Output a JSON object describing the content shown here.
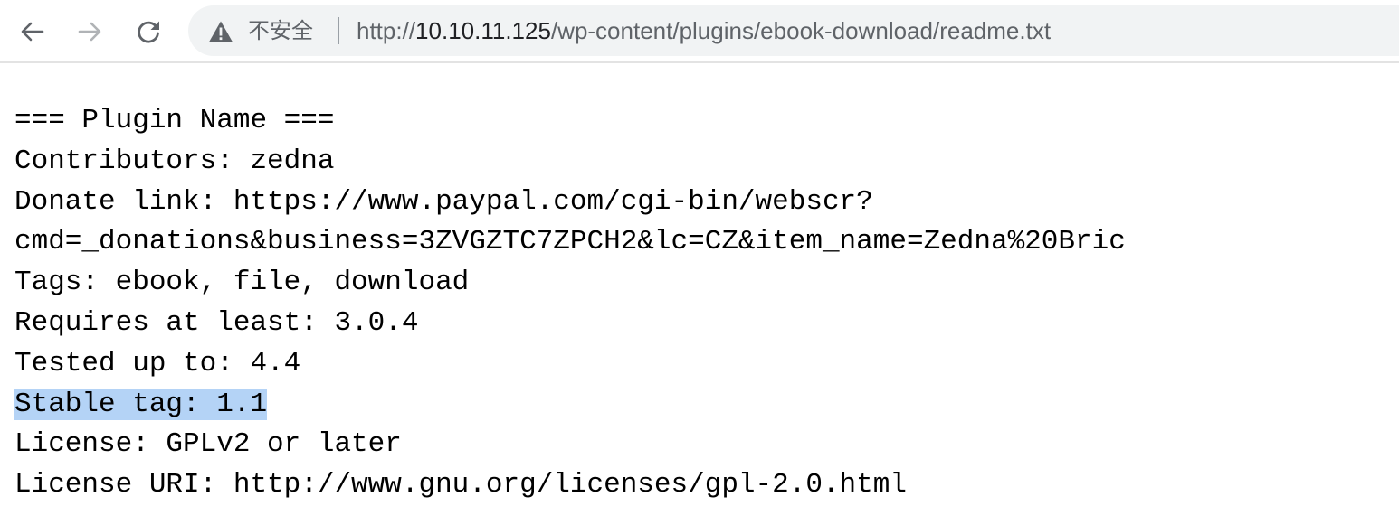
{
  "browser": {
    "security_label": "不安全",
    "url_scheme": "http://",
    "url_host": "10.10.11.125",
    "url_path": "/wp-content/plugins/ebook-download/readme.txt",
    "colors": {
      "omnibox_bg": "#f1f3f4",
      "selection": "#b4d3f6"
    },
    "icons": {
      "back": "back-arrow-icon",
      "forward": "forward-arrow-icon",
      "reload": "reload-icon",
      "security": "warning-triangle-icon"
    }
  },
  "document": {
    "lines": [
      "=== Plugin Name ===",
      "Contributors: zedna",
      "Donate link: https://www.paypal.com/cgi-bin/webscr?",
      "cmd=_donations&business=3ZVGZTC7ZPCH2&lc=CZ&item_name=Zedna%20Bric",
      "Tags: ebook, file, download",
      "Requires at least: 3.0.4",
      "Tested up to: 4.4",
      "Stable tag: 1.1",
      "License: GPLv2 or later",
      "License URI: http://www.gnu.org/licenses/gpl-2.0.html"
    ],
    "selected_line": "Stable tag: 1.1"
  }
}
